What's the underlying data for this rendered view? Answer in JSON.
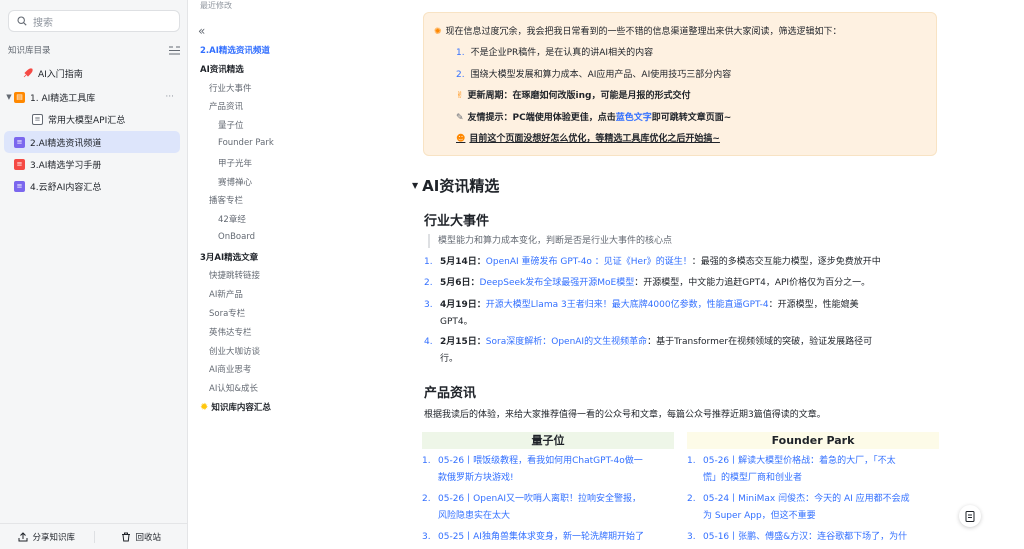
{
  "sidebar": {
    "search_placeholder": "搜索",
    "kb_title": "知识库目录",
    "items": [
      {
        "label": "AI入门指南",
        "icon": "rocket-icon",
        "color": "#f54a45"
      },
      {
        "label": "1. AI精选工具库",
        "icon": "folder-icon",
        "color": "#ff8800"
      },
      {
        "label": "常用大模型API汇总",
        "icon": "doc-icon",
        "color": "#646a73"
      },
      {
        "label": "2.AI精选资讯频道",
        "icon": "doc-icon",
        "color": "#7b67ee"
      },
      {
        "label": "3.AI精选学习手册",
        "icon": "doc-icon",
        "color": "#f54a45"
      },
      {
        "label": "4.云舒AI内容汇总",
        "icon": "doc-icon",
        "color": "#7b67ee"
      }
    ],
    "footer": {
      "share": "分享知识库",
      "trash": "回收站"
    }
  },
  "top_strip_text": "最近修改",
  "outline": {
    "current": "2.AI精选资讯频道",
    "items": [
      {
        "text": "AI资讯精选",
        "level": 1
      },
      {
        "text": "行业大事件",
        "level": 2
      },
      {
        "text": "产品资讯",
        "level": 2
      },
      {
        "text": "量子位",
        "level": 3
      },
      {
        "text": "Founder Park",
        "level": 3
      },
      {
        "text": "甲子光年",
        "level": 3
      },
      {
        "text": "赛博禅心",
        "level": 3
      },
      {
        "text": "播客专栏",
        "level": 2
      },
      {
        "text": "42章经",
        "level": 3
      },
      {
        "text": "OnBoard",
        "level": 3
      },
      {
        "text": "3月AI精选文章",
        "level": 1
      },
      {
        "text": "快捷跳转链接",
        "level": 2
      },
      {
        "text": "AI新产品",
        "level": 2
      },
      {
        "text": "Sora专栏",
        "level": 2
      },
      {
        "text": "英伟达专栏",
        "level": 2
      },
      {
        "text": "创业大咖访谈",
        "level": 2
      },
      {
        "text": "AI商业思考",
        "level": 2
      },
      {
        "text": "AI认知&成长",
        "level": 2
      },
      {
        "text": "知识库内容汇总",
        "level": 1
      }
    ]
  },
  "callout": {
    "intro": "现在信息过度冗余，我会把我日常看到的一些不错的信息渠道整理出来供大家阅读，筛选逻辑如下：",
    "rule1": "不是企业PR稿件，是在认真的讲AI相关的内容",
    "rule2": "围绕大模型发展和算力成本、AI应用产品、AI使用技巧三部分内容",
    "update": "更新周期：在琢磨如何改版ing，可能是月报的形式交付",
    "tip_prefix": "友情提示：PC端使用体验更佳，点击",
    "tip_link": "蓝色文字",
    "tip_suffix": "即可跳转文章页面~",
    "note": "目前这个页面没想好怎么优化，等精选工具库优化之后开始搞~"
  },
  "main": {
    "section_title": "AI资讯精选",
    "events_title": "行业大事件",
    "events_quote": "模型能力和算力成本变化，判断是否是行业大事件的核心点",
    "events": [
      {
        "num": "1.",
        "date": "5月14日：",
        "link": "OpenAI 重磅发布 GPT-4o ：见证《Her》的诞生！",
        "desc": "：最强的多模态交互能力模型，逐步免费放开中",
        "cont": ""
      },
      {
        "num": "2.",
        "date": "5月6日：",
        "link": "DeepSeek发布全球最强开源MoE模型",
        "desc": "：开源模型，中文能力追赶GPT4，API价格仅为百分之一。",
        "cont": ""
      },
      {
        "num": "3.",
        "date": "4月19日：",
        "link": "开源大模型Llama 3王者归来！最大底牌4000亿参数，性能直逼GPT-4",
        "desc": "：开源模型，性能媲美",
        "cont": "GPT4。"
      },
      {
        "num": "4.",
        "date": "2月15日：",
        "link": "Sora深度解析：OpenAI的文生视频革命",
        "desc": "：基于Transformer在视频领域的突破，验证发展路径可",
        "cont": "行。"
      }
    ],
    "products_title": "产品资讯",
    "products_desc": "根据我读后的体验，来给大家推荐值得一看的公众号和文章，每篇公众号推荐近期3篇值得读的文章。",
    "columns": [
      {
        "title": "量子位",
        "items": [
          {
            "num": "1.",
            "line1": "05-26丨喂饭级教程，看我如何用ChatGPT-4o做一",
            "line2": "款俄罗斯方块游戏!"
          },
          {
            "num": "2.",
            "line1": "05-26丨OpenAI又一吹哨人离职！拉响安全警报，",
            "line2": "风险隐患实在太大"
          },
          {
            "num": "3.",
            "line1": "05-25丨AI独角兽集体求变身，新一轮洗牌期开始了",
            "line2": ""
          }
        ]
      },
      {
        "title": "Founder Park",
        "items": [
          {
            "num": "1.",
            "line1": "05-26丨解读大模型价格战：着急的大厂，「不太",
            "line2": "慌」的模型厂商和创业者"
          },
          {
            "num": "2.",
            "line1": "05-24丨MiniMax 闫俊杰：今天的 AI 应用都不会成",
            "line2": "为 Super App，但这不重要"
          },
          {
            "num": "3.",
            "line1": "05-16丨张鹏、傅盛&方汉：连谷歌都下场了，为什",
            "line2": ""
          }
        ]
      }
    ]
  }
}
